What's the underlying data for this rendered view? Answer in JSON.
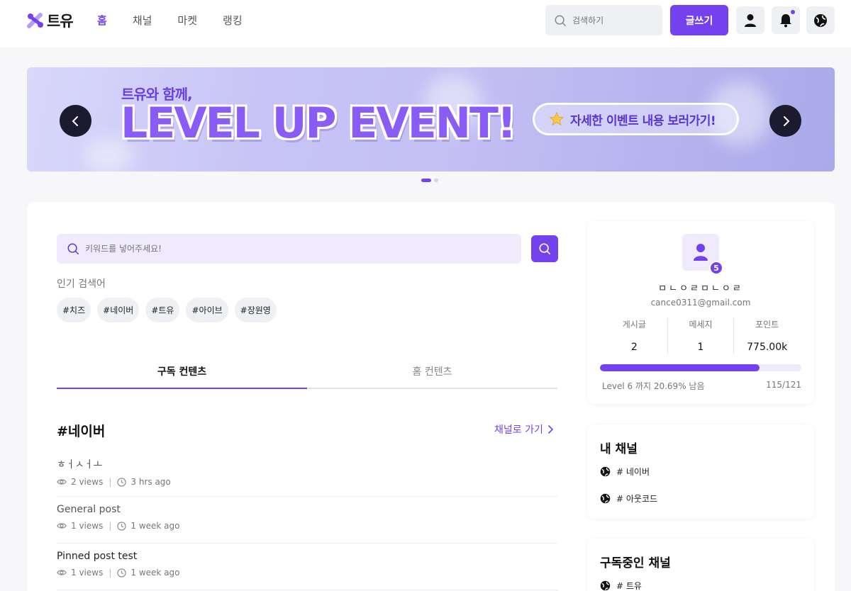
{
  "brand": {
    "name": "트유"
  },
  "nav": {
    "items": [
      "홈",
      "채널",
      "마켓",
      "랭킹"
    ],
    "active": "홈"
  },
  "header": {
    "search_placeholder": "검색하기",
    "write_label": "글쓰기"
  },
  "colors": {
    "accent": "#7540ee",
    "accent_light": "#efeafc"
  },
  "banner": {
    "subtitle": "트유와 함께,",
    "title": "LEVEL UP EVENT!",
    "cta": "자세한 이벤트 내용 보러가기!",
    "cta_icon": "star-icon",
    "slide_count": 2,
    "active_slide": 1
  },
  "search": {
    "placeholder": "키워드를 넣어주세요!"
  },
  "popular": {
    "label": "인기 검색어",
    "tags": [
      "#치즈",
      "#네이버",
      "#트유",
      "#아이브",
      "#장원영"
    ]
  },
  "tabs": [
    {
      "label": "구독 컨텐츠",
      "active": true
    },
    {
      "label": "홈 컨텐츠",
      "active": false
    }
  ],
  "channel": {
    "title": "#네이버",
    "goto_label": "채널로 가기"
  },
  "posts": [
    {
      "title": "ㅎㅓㅅㅓㅗ",
      "views": "2 views",
      "time": "3 hrs ago"
    },
    {
      "title": "General post",
      "views": "1 views",
      "time": "1 week ago"
    },
    {
      "title": "Pinned post test",
      "views": "1 views",
      "time": "1 week ago"
    }
  ],
  "profile": {
    "name": "ㅁㄴㅇㄹㅁㄴㅇㄹ",
    "email": "cance0311@gmail.com",
    "level_badge": "5",
    "stats": [
      {
        "label": "게시글",
        "value": "2"
      },
      {
        "label": "메세지",
        "value": "1"
      },
      {
        "label": "포인트",
        "value": "775.00k"
      }
    ],
    "progress": 0.7926,
    "progress_label": "Level 6 까지 20.69% 남음",
    "progress_count": "115/121"
  },
  "my_channels": {
    "title": "내 채널",
    "items": [
      "# 네이버",
      "# 아웃코드"
    ]
  },
  "subscribed_channels": {
    "title": "구독중인 채널",
    "items": [
      "# 트유"
    ]
  }
}
